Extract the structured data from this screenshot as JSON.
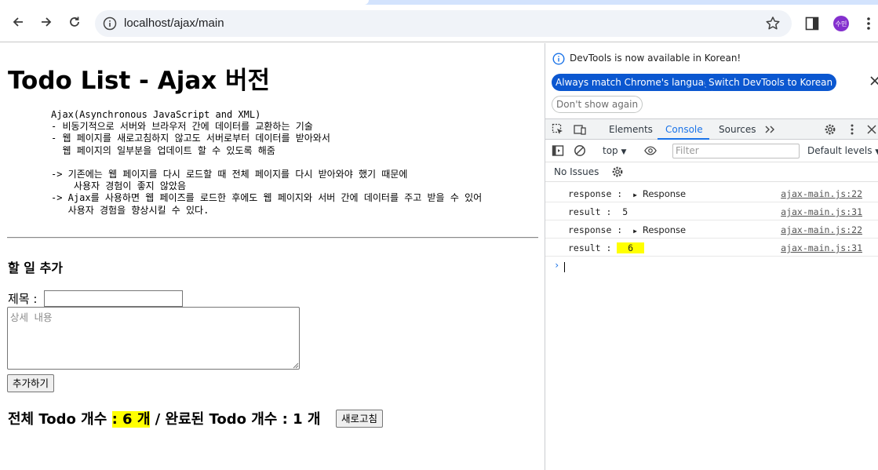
{
  "browser": {
    "url": "localhost/ajax/main",
    "avatar_text": "수민"
  },
  "page": {
    "title": "Todo List - Ajax 버전",
    "description": "Ajax(Asynchronous JavaScript and XML)\n- 비동기적으로 서버와 브라우저 간에 데이터를 교환하는 기술\n- 웹 페이지를 새로고침하지 않고도 서버로부터 데이터를 받아와서\n  웹 페이지의 일부분을 업데이트 할 수 있도록 해줌\n\n-> 기존에는 웹 페이지를 다시 로드할 때 전체 페이지를 다시 받아와야 했기 때문에\n    사용자 경험이 좋지 않았음\n-> Ajax를 사용하면 웹 페이즈를 로드한 후에도 웹 페이지와 서버 간에 데이터를 주고 받을 수 있어\n   사용자 경험을 향상시킬 수 있다.",
    "add_heading": "할 일 추가",
    "title_label": "제목 :",
    "title_value": "",
    "detail_placeholder": "상세 내용",
    "add_button": "추가하기",
    "count": {
      "total_label": "전체 Todo 개수",
      "total_value": ": 6 개",
      "separator": "/",
      "done_label": "완료된 Todo 개수",
      "done_value": ": 1 개"
    },
    "refresh_button": "새로고침",
    "highlight_color": "#ffff00"
  },
  "devtools": {
    "banner": {
      "message": "DevTools is now available in Korean!",
      "btn_match": "Always match Chrome's language",
      "btn_switch": "Switch DevTools to Korean",
      "btn_dismiss": "Don't show again"
    },
    "tabs": [
      "Elements",
      "Console",
      "Sources"
    ],
    "active_tab": "Console",
    "context": "top",
    "filter_placeholder": "Filter",
    "levels": "Default levels",
    "issues": "No Issues",
    "logs": [
      {
        "label": "response : ",
        "value": "Response",
        "source": "ajax-main.js:22"
      },
      {
        "label": "result : ",
        "value": "5",
        "source": "ajax-main.js:31"
      },
      {
        "label": "response : ",
        "value": "Response",
        "source": "ajax-main.js:22"
      },
      {
        "label": "result : ",
        "value": "6",
        "source": "ajax-main.js:31"
      }
    ],
    "prompt": "›",
    "accent": "#1a73e8",
    "button_blue": "#0b57d0"
  }
}
